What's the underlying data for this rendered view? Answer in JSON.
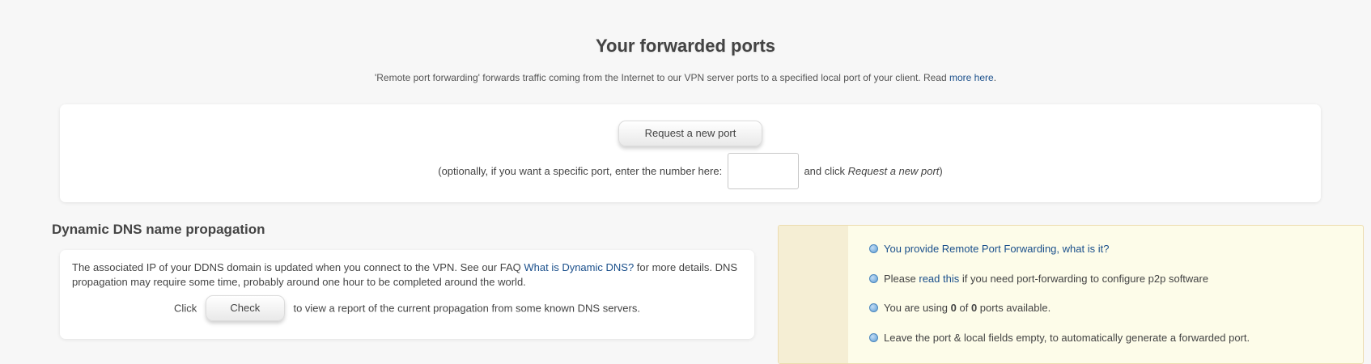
{
  "header": {
    "title": "Your forwarded ports",
    "subtitle_text": "'Remote port forwarding' forwards traffic coming from the Internet to our VPN server ports to a specified local port of your client. Read ",
    "subtitle_link": "more here",
    "subtitle_end": "."
  },
  "port_request": {
    "button_label": "Request a new port",
    "hint_before": "(optionally, if you want a specific port, enter the number here:",
    "port_value": "",
    "hint_after_prefix": "and click ",
    "hint_after_em": "Request a new port",
    "hint_after_suffix": ")"
  },
  "ddns": {
    "title": "Dynamic DNS name propagation",
    "text_part1": "The associated IP of your DDNS domain is updated when you connect to the VPN. See our FAQ ",
    "faq_link": "What is Dynamic DNS?",
    "text_part2": " for more details. DNS propagation may require some time, probably around one hour to be completed around the world.",
    "click_label": "Click",
    "check_button": "Check",
    "check_after": "to view a report of the current propagation from some known DNS servers."
  },
  "info": {
    "item1_link": "You provide Remote Port Forwarding, what is it?",
    "item2_before": "Please ",
    "item2_link": "read this",
    "item2_after": " if you need port-forwarding to configure p2p software",
    "item3_before": "You are using ",
    "item3_used": "0",
    "item3_mid": " of ",
    "item3_total": "0",
    "item3_after": " ports available.",
    "item4_text": "Leave the port & local fields empty, to automatically generate a forwarded port."
  },
  "colors": {
    "link": "#1a4f8b",
    "info_background": "#fdfce9",
    "page_background": "#f7f7f7"
  },
  "icons": {
    "info_bullet": "blue-circle-bullet-icon"
  }
}
